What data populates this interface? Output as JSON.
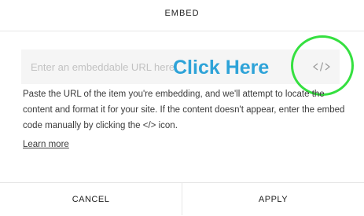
{
  "dialog": {
    "title": "EMBED"
  },
  "url_field": {
    "placeholder": "Enter an embeddable URL here",
    "value": ""
  },
  "annotation": {
    "callout_text": "Click Here",
    "callout_color": "#2ea3d8",
    "circle_color": "#35e040"
  },
  "embed_code_button": {
    "icon": "code-icon",
    "glyph": "</>"
  },
  "description": {
    "text": "Paste the URL of the item you're embedding, and we'll attempt to locate the content and format it for your site. If the content doesn't appear, enter the embed code manually by clicking the </> icon."
  },
  "learn_more": {
    "label": "Learn more"
  },
  "footer": {
    "cancel_label": "CANCEL",
    "apply_label": "APPLY"
  }
}
